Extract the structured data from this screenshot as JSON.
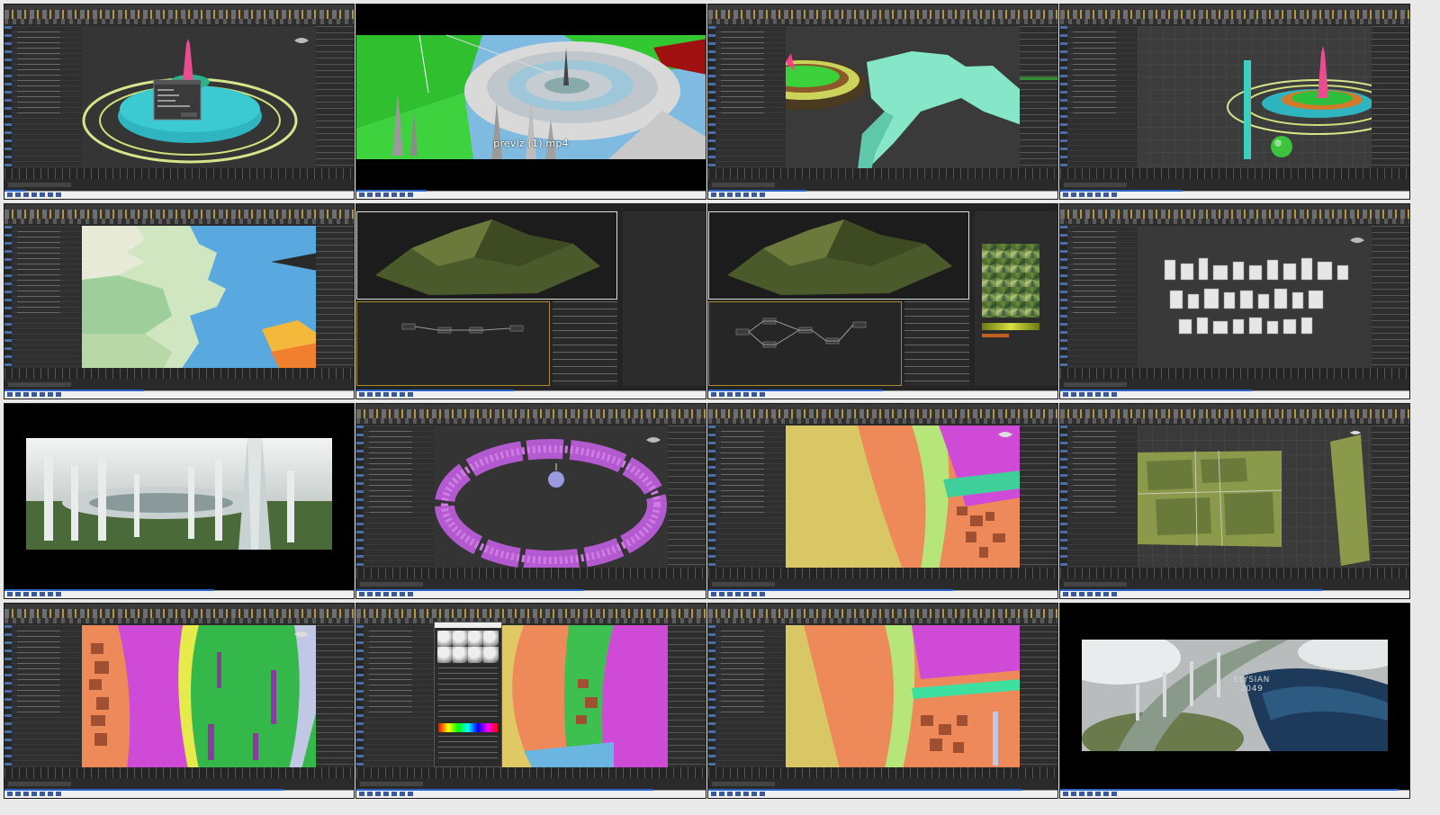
{
  "cells": [
    {
      "name": "fountain-scene",
      "progress": 0.06
    },
    {
      "name": "previz-video",
      "progress": 0.2
    },
    {
      "name": "shoreline-scene",
      "progress": 0.28
    },
    {
      "name": "tower-scene",
      "progress": 0.35
    },
    {
      "name": "terrain-map-scene",
      "progress": 0.4
    },
    {
      "name": "terrain-graph-editor",
      "progress": 0.45
    },
    {
      "name": "terrain-texture-editor",
      "progress": 0.5
    },
    {
      "name": "buildings-library-scene",
      "progress": 0.55
    },
    {
      "name": "city-render",
      "progress": 0.6
    },
    {
      "name": "ring-scatter-scene",
      "progress": 0.65
    },
    {
      "name": "id-map-scene-1",
      "progress": 0.7
    },
    {
      "name": "fields-scene",
      "progress": 0.75
    },
    {
      "name": "id-map-scene-2",
      "progress": 0.8
    },
    {
      "name": "material-editor-scene",
      "progress": 0.85
    },
    {
      "name": "id-map-scene-3",
      "progress": 0.9
    },
    {
      "name": "final-render",
      "progress": 0.97
    }
  ],
  "video_caption": "previz (1).mp4",
  "title_card": {
    "line1": "ELYSIAN",
    "line2": "2049"
  },
  "colors": {
    "ui_dark": "#2b2b2b",
    "toolbar": "#353535",
    "accent": "#c9a23a",
    "selection": "#4a6fa5",
    "playbar": "#f0f0f0"
  }
}
